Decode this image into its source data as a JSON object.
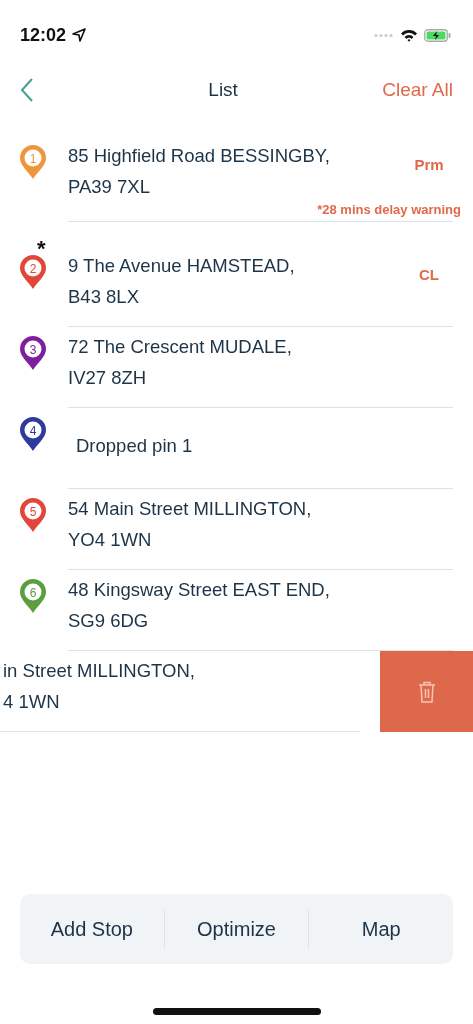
{
  "status_bar": {
    "time": "12:02"
  },
  "nav": {
    "title": "List",
    "action": "Clear All"
  },
  "stops": [
    {
      "kind": "stop",
      "number": "1",
      "color": "#f0963a",
      "lines": [
        "85 Highfield Road BESSINGBY,",
        "PA39 7XL"
      ],
      "tag": "Prm",
      "warning": "*28 mins delay warning"
    },
    {
      "kind": "stop",
      "number": "2",
      "color": "#e2463a",
      "lines": [
        "9 The Avenue HAMSTEAD,",
        "B43 8LX"
      ],
      "tag": "CL",
      "mark": "*"
    },
    {
      "kind": "stop",
      "number": "3",
      "color": "#7e1f9e",
      "lines": [
        "72 The Crescent MUDALE,",
        "IV27 8ZH"
      ]
    },
    {
      "kind": "stop",
      "number": "4",
      "color": "#2e3a9c",
      "lines": [
        "Dropped pin 1"
      ]
    },
    {
      "kind": "stop",
      "number": "5",
      "color": "#e2463a",
      "lines": [
        "54 Main Street MILLINGTON,",
        "YO4 1WN"
      ]
    },
    {
      "kind": "stop",
      "number": "6",
      "color": "#5a9e3e",
      "lines": [
        "48 Kingsway Street EAST END,",
        "SG9 6DG"
      ]
    },
    {
      "kind": "swiped",
      "lines": [
        "in Street MILLINGTON,",
        "4 1WN"
      ]
    }
  ],
  "toolbar": [
    "Add Stop",
    "Optimize",
    "Map"
  ]
}
